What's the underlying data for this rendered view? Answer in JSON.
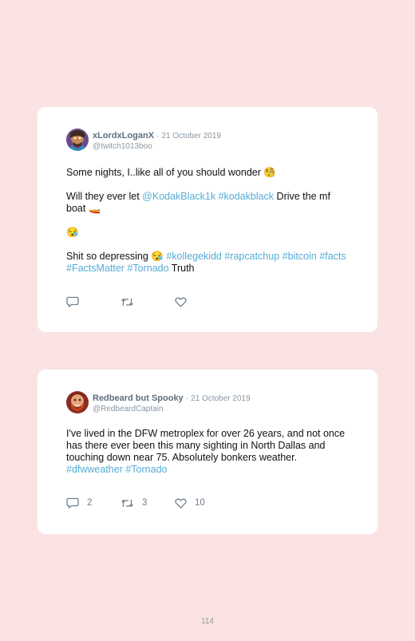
{
  "tweets": [
    {
      "name": "xLordxLoganX",
      "dot": "·",
      "date": "21 October 2019",
      "handle": "@twitch1013boo",
      "p1": "Some nights, I..like all of you should wonder 🧐",
      "p2a": "Will they ever let ",
      "p2_mention": "@KodakBlack1k",
      "p2_sp": " ",
      "p2_tag": "#kodakblack",
      "p2b": " Drive the mf boat 🚤",
      "p3": "😪",
      "p4a": "Shit so depressing 😪 ",
      "tags": [
        "#kollegekidd",
        "#rapcatchup",
        "#bitcoin",
        "#facts",
        "#FactsMatter",
        "#Tornado"
      ],
      "p4b": " Truth",
      "counts": {
        "reply": "",
        "retweet": "",
        "like": ""
      },
      "icons": [
        "reply-icon",
        "retweet-icon",
        "heart-icon"
      ]
    },
    {
      "name": "Redbeard but Spooky",
      "dot": "·",
      "date": "21 October 2019",
      "handle": "@RedbeardCaptain",
      "p1": "I've lived in the DFW metroplex for over 26 years, and not once has there ever been this many sighting in North Dallas and touching down near 75. Absolutely bonkers weather.",
      "tags": [
        "#dfwweather",
        "#Tornado"
      ],
      "counts": {
        "reply": "2",
        "retweet": "3",
        "like": "10"
      },
      "icons": [
        "reply-icon",
        "retweet-icon",
        "heart-icon"
      ]
    }
  ],
  "page_number": "114",
  "colors": {
    "background": "#fbe3e3",
    "card": "#ffffff",
    "link": "#55acd6",
    "muted": "#8a97a3"
  }
}
